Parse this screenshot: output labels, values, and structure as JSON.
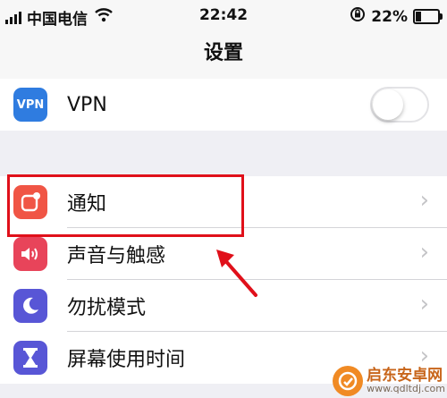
{
  "status_bar": {
    "carrier": "中国电信",
    "time": "22:42",
    "battery_percent": "22%",
    "battery_level": 0.22
  },
  "nav": {
    "title": "设置"
  },
  "vpn": {
    "label": "VPN",
    "icon_text": "VPN",
    "enabled": false,
    "icon": "vpn-icon"
  },
  "settings": [
    {
      "label": "通知",
      "icon": "notification-icon",
      "color": "#f05545"
    },
    {
      "label": "声音与触感",
      "icon": "speaker-icon",
      "color": "#e8445a"
    },
    {
      "label": "勿扰模式",
      "icon": "moon-icon",
      "color": "#5856d6"
    },
    {
      "label": "屏幕使用时间",
      "icon": "hourglass-icon",
      "color": "#5856d6"
    }
  ],
  "watermark": {
    "name": "启东安卓网",
    "url": "www.qdltdj.com"
  }
}
